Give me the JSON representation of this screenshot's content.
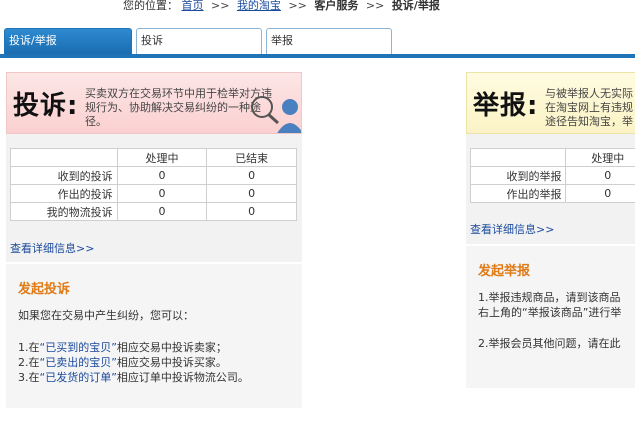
{
  "breadcrumb": {
    "prefix": "您的位置：",
    "home": "首页",
    "my_taobao": "我的淘宝",
    "customer_service": "客户服务",
    "current": "投诉/举报",
    "separator": ">>"
  },
  "tabs": [
    {
      "label": "投诉/举报",
      "active": true
    },
    {
      "label": "投诉",
      "active": false
    },
    {
      "label": "举报",
      "active": false
    }
  ],
  "complaint": {
    "title": "投诉:",
    "description_lines": [
      "买卖双方在交易环节中用于检举对方违",
      "规行为、协助解决交易纠纷的一种途",
      "径。"
    ],
    "table": {
      "headers": [
        "",
        "处理中",
        "已结束"
      ],
      "rows": [
        {
          "label": "收到的投诉",
          "processing": "0",
          "finished": "0"
        },
        {
          "label": "作出的投诉",
          "processing": "0",
          "finished": "0"
        },
        {
          "label": "我的物流投诉",
          "processing": "0",
          "finished": "0"
        }
      ]
    },
    "detail_link": "查看详细信息>>",
    "start": {
      "title": "发起投诉",
      "intro": "如果您在交易中产生纠纷，您可以：",
      "items": [
        {
          "prefix": "1.在",
          "link": "“已买到的宝贝”",
          "suffix": "相应交易中投诉卖家；"
        },
        {
          "prefix": "2.在",
          "link": "“已卖出的宝贝”",
          "suffix": "相应交易中投诉买家。"
        },
        {
          "prefix": "3.在",
          "link": "“已发货的订单”",
          "suffix": "相应订单中投诉物流公司。"
        }
      ]
    }
  },
  "report": {
    "title": "举报:",
    "description_lines": [
      "与被举报人无实际",
      "在淘宝网上有违规",
      "途径告知淘宝，举"
    ],
    "table": {
      "headers": [
        "",
        "处理中"
      ],
      "rows": [
        {
          "label": "收到的举报",
          "processing": "0"
        },
        {
          "label": "作出的举报",
          "processing": "0"
        }
      ]
    },
    "detail_link": "查看详细信息>>",
    "start": {
      "title": "发起举报",
      "lines": [
        "1.举报违规商品，请到该商品",
        "右上角的“举报该商品”进行举",
        "2.举报会员其他问题，请在此"
      ]
    }
  },
  "colors": {
    "tab_active": "#1f74b8",
    "link": "#1a4a9c",
    "section_title": "#e07a14",
    "complaint_banner": "#fbd0d0",
    "report_banner": "#fbf3c6"
  }
}
